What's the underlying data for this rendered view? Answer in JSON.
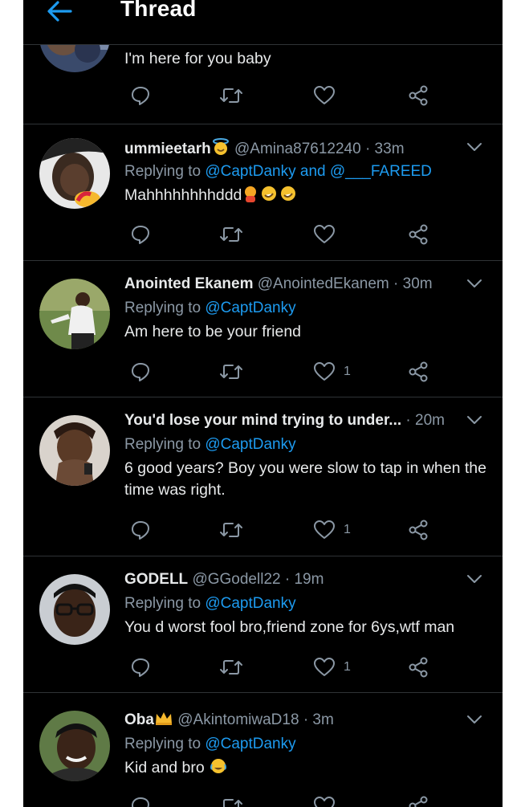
{
  "header": {
    "title": "Thread"
  },
  "first_tweet": {
    "text": "I'm here for you baby"
  },
  "tweets": [
    {
      "name": "ummieetarh",
      "handle": "@Amina87612240",
      "time": "· 33m",
      "reply_prefix": "Replying to",
      "reply_to": "@CaptDanky and @___FAREED",
      "text": "Mahhhhhhhhddd",
      "likes": ""
    },
    {
      "name": "Anointed Ekanem",
      "handle": "@AnointedEkanem",
      "time": "· 30m",
      "reply_prefix": "Replying to",
      "reply_to": "@CaptDanky",
      "text": "Am here to be your friend",
      "likes": "1"
    },
    {
      "name": "You'd lose your mind trying to under...",
      "handle": "",
      "time": "· 20m",
      "reply_prefix": "Replying to",
      "reply_to": "@CaptDanky",
      "text": "6 good years? Boy you were slow to tap in when the time was right.",
      "likes": "1"
    },
    {
      "name": "GODELL",
      "handle": "@GGodell22",
      "time": "· 19m",
      "reply_prefix": "Replying to",
      "reply_to": "@CaptDanky",
      "text": "You d worst fool bro,friend zone for 6ys,wtf man",
      "likes": "1"
    },
    {
      "name": "Oba",
      "handle": "@AkintomiwaD18",
      "time": "· 3m",
      "reply_prefix": "Replying to",
      "reply_to": "@CaptDanky",
      "text": "Kid and bro",
      "likes": ""
    }
  ],
  "icons": {
    "back": "arrow-left-icon",
    "reply": "reply-icon",
    "retweet": "retweet-icon",
    "like": "heart-icon",
    "share": "share-icon",
    "more": "chevron-down-icon"
  },
  "colors": {
    "background": "#000000",
    "accent": "#1d9bf0",
    "text": "#e7e9ea",
    "muted": "#8b98a5",
    "divider": "#2f3336"
  }
}
